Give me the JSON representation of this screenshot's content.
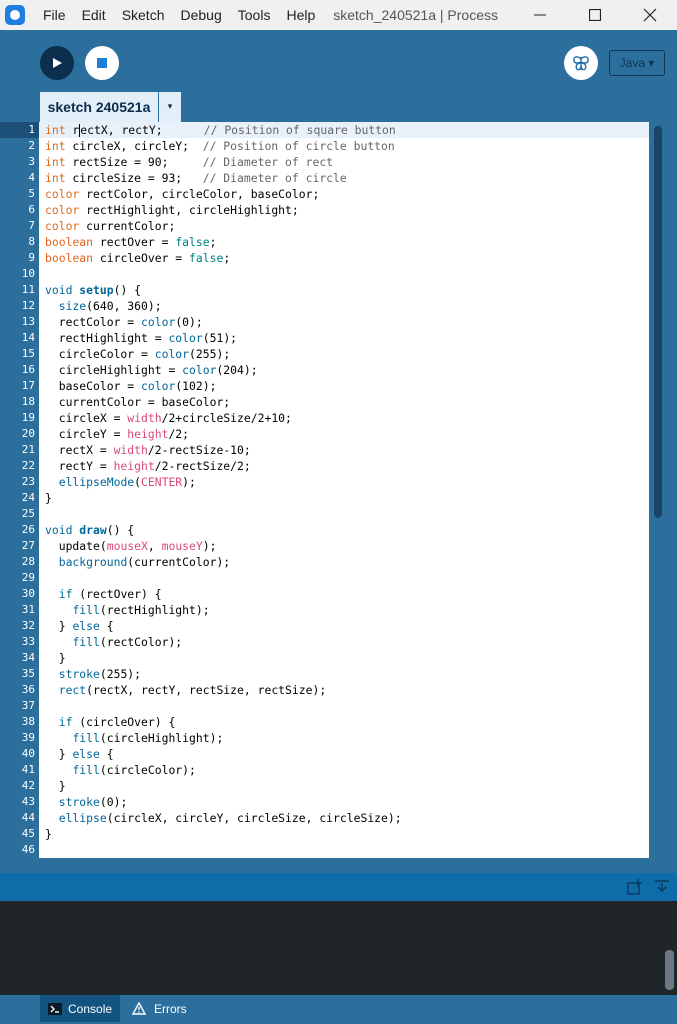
{
  "menubar": {
    "items": [
      "File",
      "Edit",
      "Sketch",
      "Debug",
      "Tools",
      "Help"
    ],
    "window_title": "sketch_240521a | Process…"
  },
  "toolbar": {
    "run_icon": "play-icon",
    "stop_icon": "stop-icon",
    "debug_icon": "butterfly-icon",
    "mode_label": "Java ▾"
  },
  "tabs": {
    "active": "sketch 240521a",
    "menu_glyph": "▾"
  },
  "editor": {
    "current_line": 1,
    "line_numbers": [
      "1",
      "2",
      "3",
      "4",
      "5",
      "6",
      "7",
      "8",
      "9",
      "10",
      "11",
      "12",
      "13",
      "14",
      "15",
      "16",
      "17",
      "18",
      "19",
      "20",
      "21",
      "22",
      "23",
      "24",
      "25",
      "26",
      "27",
      "28",
      "29",
      "30",
      "31",
      "32",
      "33",
      "34",
      "35",
      "36",
      "37",
      "38",
      "39",
      "40",
      "41",
      "42",
      "43",
      "44",
      "45",
      "46"
    ],
    "code": {
      "l1": "int rectX, rectY;      // Position of square button",
      "l2": "int circleX, circleY;  // Position of circle button",
      "l3": "int rectSize = 90;     // Diameter of rect",
      "l4": "int circleSize = 93;   // Diameter of circle",
      "l5": "color rectColor, circleColor, baseColor;",
      "l6": "color rectHighlight, circleHighlight;",
      "l7": "color currentColor;",
      "l8": "boolean rectOver = false;",
      "l9": "boolean circleOver = false;",
      "l10": "",
      "l11": "void setup() {",
      "l12": "  size(640, 360);",
      "l13": "  rectColor = color(0);",
      "l14": "  rectHighlight = color(51);",
      "l15": "  circleColor = color(255);",
      "l16": "  circleHighlight = color(204);",
      "l17": "  baseColor = color(102);",
      "l18": "  currentColor = baseColor;",
      "l19": "  circleX = width/2+circleSize/2+10;",
      "l20": "  circleY = height/2;",
      "l21": "  rectX = width/2-rectSize-10;",
      "l22": "  rectY = height/2-rectSize/2;",
      "l23": "  ellipseMode(CENTER);",
      "l24": "}",
      "l25": "",
      "l26": "void draw() {",
      "l27": "  update(mouseX, mouseY);",
      "l28": "  background(currentColor);",
      "l29": "",
      "l30": "  if (rectOver) {",
      "l31": "    fill(rectHighlight);",
      "l32": "  } else {",
      "l33": "    fill(rectColor);",
      "l34": "  }",
      "l35": "  stroke(255);",
      "l36": "  rect(rectX, rectY, rectSize, rectSize);",
      "l37": "",
      "l38": "  if (circleOver) {",
      "l39": "    fill(circleHighlight);",
      "l40": "  } else {",
      "l41": "    fill(circleColor);",
      "l42": "  }",
      "l43": "  stroke(0);",
      "l44": "  ellipse(circleX, circleY, circleSize, circleSize);",
      "l45": "}",
      "l46": ""
    }
  },
  "console": {
    "add_icon": "add-panel-icon",
    "collapse_icon": "collapse-icon"
  },
  "bottom_tabs": {
    "console_label": "Console",
    "errors_label": "Errors"
  },
  "colors": {
    "chrome_blue": "#2c6f9d",
    "keyword_orange": "#e2661a",
    "function_blue": "#006699",
    "literal_pink": "#d94a7a",
    "comment_gray": "#666666",
    "boolean_teal": "#008080",
    "console_dark": "#1f2529"
  }
}
